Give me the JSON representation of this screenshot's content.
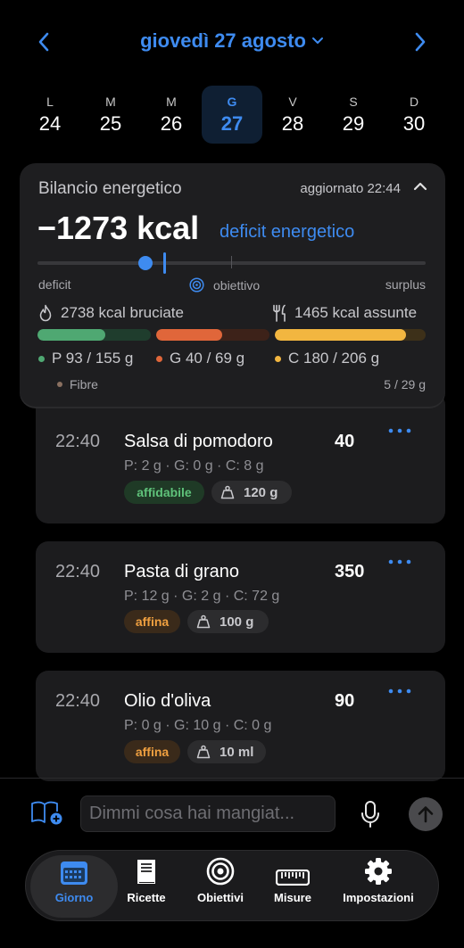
{
  "header": {
    "date_title": "giovedì 27 agosto",
    "accent_color": "#3e8bf0"
  },
  "week": [
    {
      "letter": "L",
      "num": "24"
    },
    {
      "letter": "M",
      "num": "25"
    },
    {
      "letter": "M",
      "num": "26"
    },
    {
      "letter": "G",
      "num": "27",
      "selected": true
    },
    {
      "letter": "V",
      "num": "28"
    },
    {
      "letter": "S",
      "num": "29"
    },
    {
      "letter": "D",
      "num": "30"
    }
  ],
  "energy": {
    "title": "Bilancio energetico",
    "updated": "aggiornato 22:44",
    "balance": "−1273 kcal",
    "balance_label": "deficit energetico",
    "scale_left": "deficit",
    "scale_center": "obiettivo",
    "scale_right": "surplus",
    "burned": "2738 kcal bruciate",
    "consumed": "1465 kcal assunte",
    "bars": [
      {
        "name": "protein",
        "color": "#4fa872",
        "fraction": 0.6
      },
      {
        "name": "fat",
        "color": "#e0663a",
        "fraction": 0.58
      },
      {
        "name": "carbs",
        "color": "#f2b640",
        "fraction": 0.87
      }
    ],
    "macros": {
      "p": "P 93 / 155 g",
      "g": "G 40 / 69 g",
      "c": "C 180 / 206 g"
    },
    "fibre_label": "Fibre",
    "fibre_value": "5 / 29 g"
  },
  "meals": [
    {
      "time": "22:40",
      "name": "Salsa di pomodoro",
      "kcal": "40",
      "macros": "P: 2 g · G: 0 g · C: 8 g",
      "tag": "affidabile",
      "tag_type": "green",
      "qty": "120 g"
    },
    {
      "time": "22:40",
      "name": "Pasta di grano",
      "kcal": "350",
      "macros": "P: 12 g · G: 2 g · C: 72 g",
      "tag": "affina",
      "tag_type": "orange",
      "qty": "100 g"
    },
    {
      "time": "22:40",
      "name": "Olio d'oliva",
      "kcal": "90",
      "macros": "P: 0 g · G: 10 g · C: 0 g",
      "tag": "affina",
      "tag_type": "orange",
      "qty": "10 ml"
    }
  ],
  "input": {
    "placeholder": "Dimmi cosa hai mangiat..."
  },
  "tabs": [
    {
      "label": "Giorno",
      "icon": "calendar-icon",
      "active": true
    },
    {
      "label": "Ricette",
      "icon": "book-icon"
    },
    {
      "label": "Obiettivi",
      "icon": "target-icon"
    },
    {
      "label": "Misure",
      "icon": "ruler-icon"
    },
    {
      "label": "Impostazioni",
      "icon": "gear-icon"
    }
  ]
}
